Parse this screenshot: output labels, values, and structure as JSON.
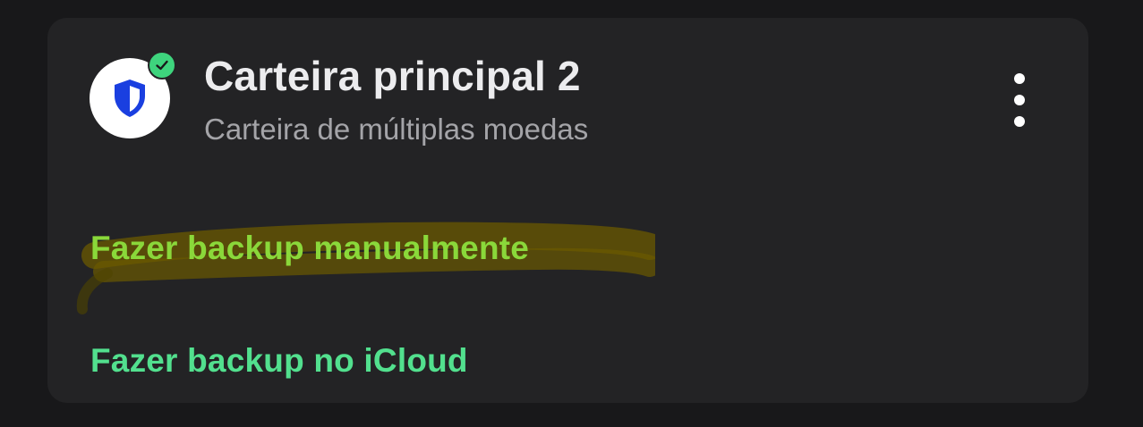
{
  "wallet": {
    "title": "Carteira principal 2",
    "subtitle": "Carteira de múltiplas moedas",
    "avatar_icon": "shield-icon",
    "status_icon": "check-icon",
    "menu_icon": "more-vertical-icon"
  },
  "actions": {
    "manual_backup_label": "Fazer backup manualmente",
    "icloud_backup_label": "Fazer backup no iCloud"
  },
  "colors": {
    "background": "#18181a",
    "card": "#232325",
    "title": "#ececee",
    "subtitle": "#a4a4a8",
    "manual_backup": "#8ad83a",
    "icloud_backup": "#52e08e",
    "shield": "#1a3fe0",
    "verified_badge": "#3ed47d",
    "highlight_stroke": "#6b5a00"
  }
}
